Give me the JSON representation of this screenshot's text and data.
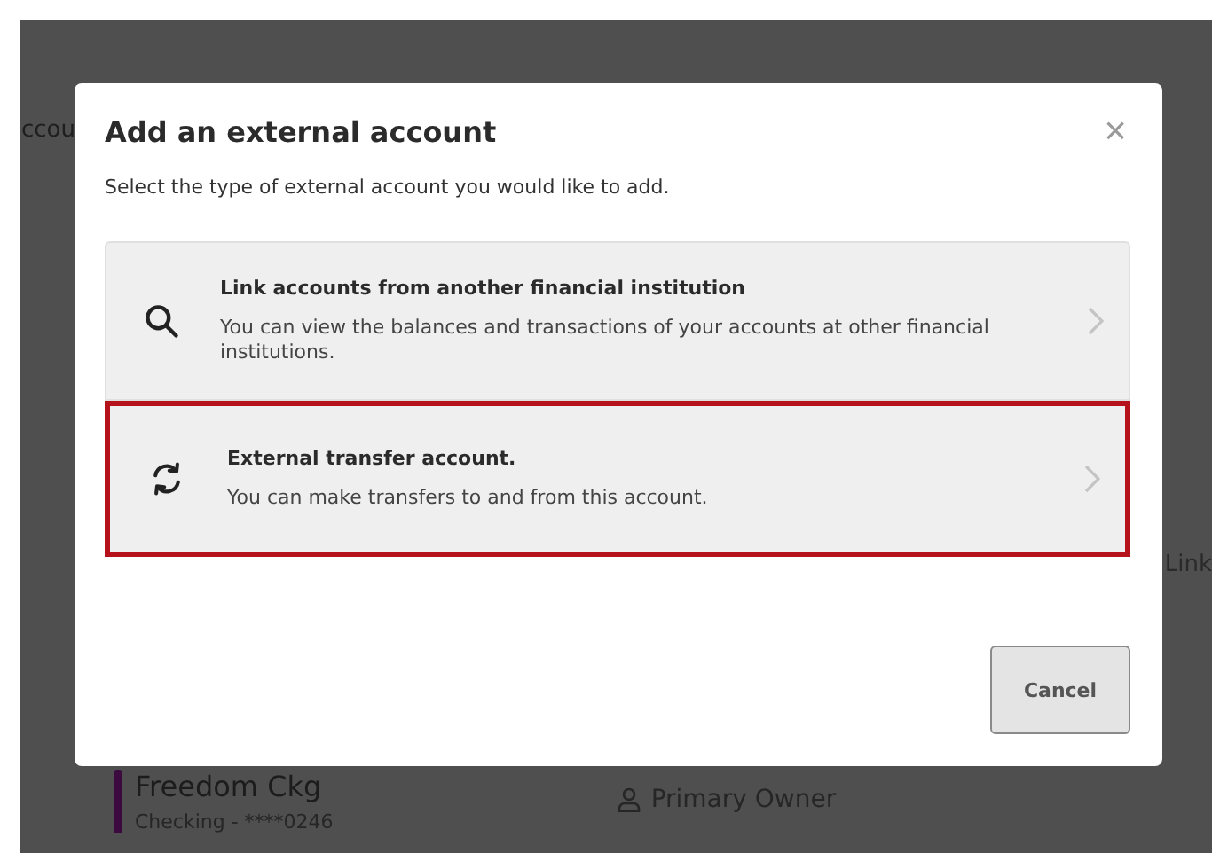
{
  "background_page": {
    "side_label": "ccou",
    "side_link": "Link",
    "account": {
      "name": "Freedom Ckg",
      "detail": "Checking - ****0246",
      "color": "#3d0a3f",
      "role": "Primary Owner"
    }
  },
  "dialog": {
    "title": "Add an external account",
    "close_label": "×",
    "subtitle": "Select the type of external account you would like to add.",
    "options": [
      {
        "kind": "search",
        "title": "Link accounts from another financial institution",
        "description": "You can view the balances and transactions of your accounts at other financial institutions.",
        "selected": false
      },
      {
        "kind": "transfer",
        "title": "External transfer account.",
        "description": "You can make transfers to and from this account.",
        "selected": true
      }
    ],
    "buttons": [
      {
        "label": "Cancel"
      }
    ]
  }
}
